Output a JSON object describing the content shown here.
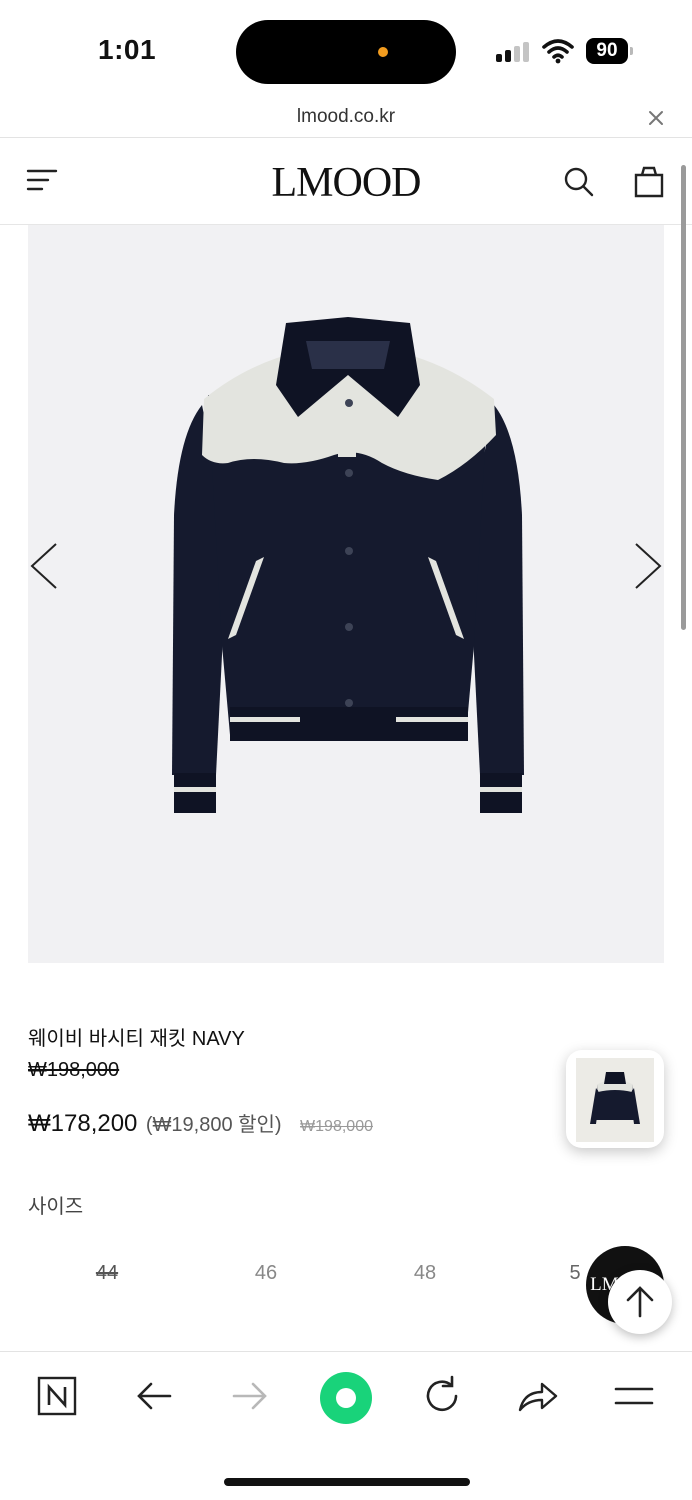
{
  "status_bar": {
    "time": "1:01",
    "battery": "90",
    "indicator_color": "#f29c1f"
  },
  "browser": {
    "url": "lmood.co.kr",
    "close_icon": "close-icon"
  },
  "header": {
    "logo": "LMOOD",
    "menu_icon": "menu-icon",
    "search_icon": "search-icon",
    "bag_icon": "shopping-bag-icon"
  },
  "product": {
    "name": "웨이비 바시티 재킷 NAVY",
    "original_price": "₩198,000",
    "sale_price": "₩178,200",
    "discount": "(₩19,800 할인)",
    "compare_price": "₩198,000",
    "image_colors": {
      "body": "#151a2e",
      "yoke": "#e3e4df",
      "background": "#f1f1f3"
    }
  },
  "sizes": {
    "label": "사이즈",
    "options": [
      {
        "label": "44",
        "sold_out": true
      },
      {
        "label": "46",
        "sold_out": false
      },
      {
        "label": "48",
        "sold_out": false
      },
      {
        "label": "5",
        "sold_out": true
      }
    ]
  },
  "floating": {
    "chat_label": "LMOOD",
    "scroll_top_icon": "arrow-up-icon"
  },
  "toolbar": {
    "icons": [
      "naver-icon",
      "back-arrow-icon",
      "forward-arrow-icon",
      "green-dot-icon",
      "reload-icon",
      "share-icon",
      "hamburger-icon"
    ],
    "accent": "#19d37a"
  }
}
